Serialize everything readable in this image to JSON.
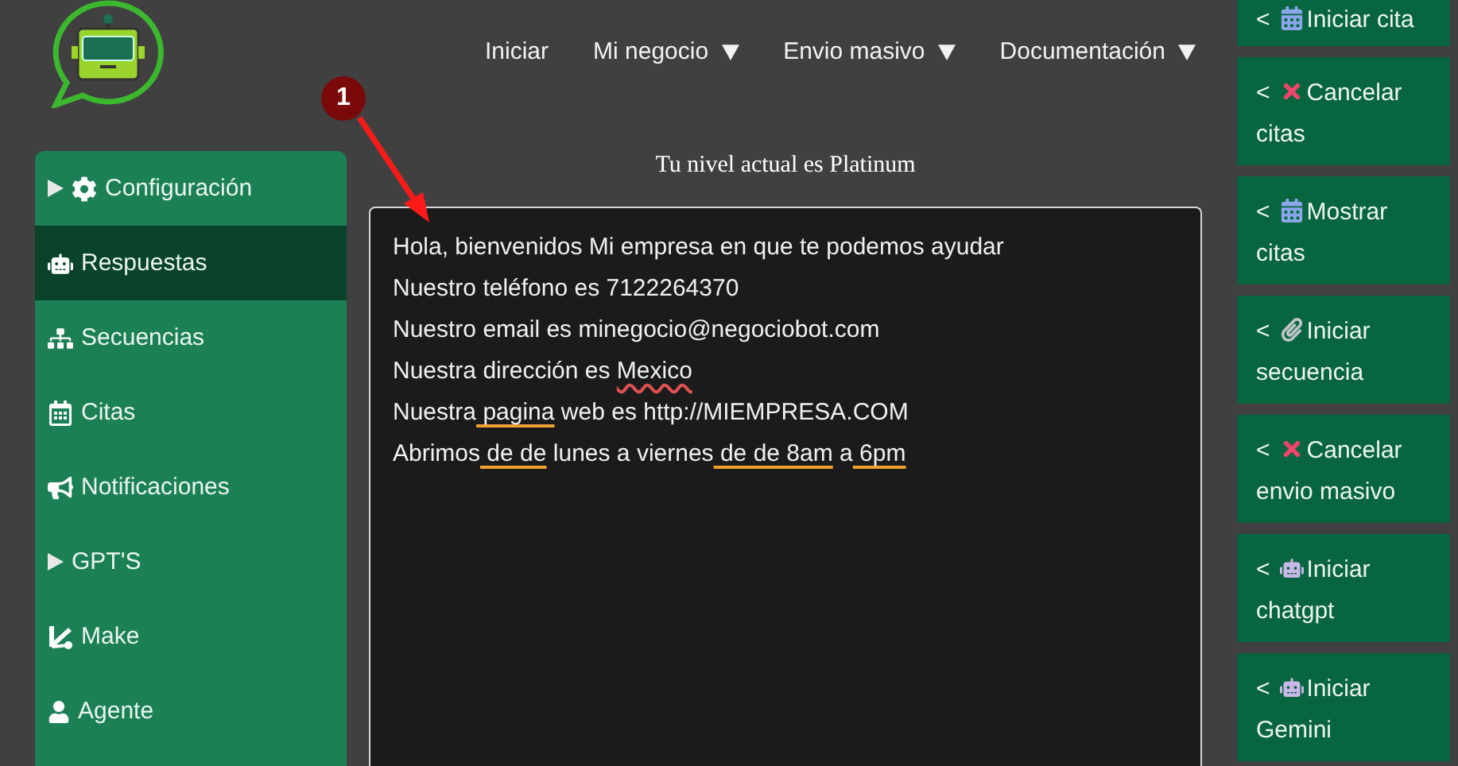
{
  "nav": [
    {
      "label": "Iniciar",
      "dropdown": false
    },
    {
      "label": "Mi negocio",
      "dropdown": true
    },
    {
      "label": "Envio masivo",
      "dropdown": true
    },
    {
      "label": "Documentación",
      "dropdown": true
    }
  ],
  "sidebar": {
    "items": [
      {
        "label": "Configuración",
        "expandable": true,
        "selected": false
      },
      {
        "label": "Respuestas",
        "expandable": false,
        "selected": true
      },
      {
        "label": "Secuencias",
        "expandable": false,
        "selected": false
      },
      {
        "label": "Citas",
        "expandable": false,
        "selected": false
      },
      {
        "label": "Notificaciones",
        "expandable": false,
        "selected": false
      },
      {
        "label": "GPT'S",
        "expandable": true,
        "selected": false
      },
      {
        "label": "Make",
        "expandable": false,
        "selected": false
      },
      {
        "label": "Agente",
        "expandable": false,
        "selected": false
      }
    ]
  },
  "level_caption": "Tu nivel actual es Platinum",
  "editor": {
    "lines": [
      [
        {
          "text": "Hola, bienvenidos Mi empresa en que te podemos ayudar",
          "kind": "plain"
        }
      ],
      [
        {
          "text": "Nuestro teléfono es 7122264370",
          "kind": "plain"
        }
      ],
      [
        {
          "text": "Nuestro email es minegocio@negociobot.com",
          "kind": "plain"
        }
      ],
      [
        {
          "text": "Nuestra dirección es ",
          "kind": "plain"
        },
        {
          "text": "Mexico",
          "kind": "spelling"
        }
      ],
      [
        {
          "text": "Nuestra",
          "kind": "plain"
        },
        {
          "text": " pagina",
          "kind": "grammar"
        },
        {
          "text": " web es http://MIEMPRESA.COM",
          "kind": "plain"
        }
      ],
      [
        {
          "text": "Abrimos",
          "kind": "plain"
        },
        {
          "text": " de de",
          "kind": "grammar"
        },
        {
          "text": " lunes a viernes",
          "kind": "plain"
        },
        {
          "text": " de de",
          "kind": "grammar"
        },
        {
          "text": " 8am",
          "kind": "grammar"
        },
        {
          "text": " a",
          "kind": "plain"
        },
        {
          "text": " 6pm",
          "kind": "grammar"
        }
      ]
    ]
  },
  "annotation": {
    "label": "1"
  },
  "actions": [
    {
      "prefix": "<",
      "label": "Iniciar cita"
    },
    {
      "prefix": "<",
      "label": "Cancelar citas"
    },
    {
      "prefix": "<",
      "label": "Mostrar citas"
    },
    {
      "prefix": "<",
      "label": "Iniciar secuencia"
    },
    {
      "prefix": "<",
      "label": "Cancelar envio masivo"
    },
    {
      "prefix": "<",
      "label": "Iniciar chatgpt"
    },
    {
      "prefix": "<",
      "label": "Iniciar Gemini"
    }
  ]
}
